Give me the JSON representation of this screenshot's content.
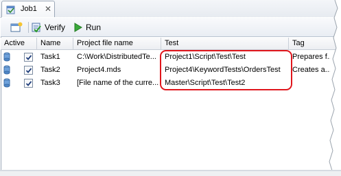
{
  "tab": {
    "title": "Job1",
    "close_label": "✕"
  },
  "toolbar": {
    "verify_label": "Verify",
    "run_label": "Run"
  },
  "grid": {
    "columns": [
      "Active",
      "Name",
      "Project file name",
      "Test",
      "Tag"
    ],
    "rows": [
      {
        "active": true,
        "name": "Task1",
        "project_file": "C:\\Work\\DistributedTe...",
        "test": "Project1\\Script\\Test\\Test",
        "tag": "Prepares f..."
      },
      {
        "active": true,
        "name": "Task2",
        "project_file": "Project4.mds",
        "test": "Project4\\KeywordTests\\OrdersTest",
        "tag": "Creates a..."
      },
      {
        "active": true,
        "name": "Task3",
        "project_file": "[File name of the curre...",
        "test": "Master\\Script\\Test\\Test2",
        "tag": ""
      }
    ]
  },
  "colors": {
    "highlight": "#e0151b",
    "border": "#9aa6b6"
  }
}
